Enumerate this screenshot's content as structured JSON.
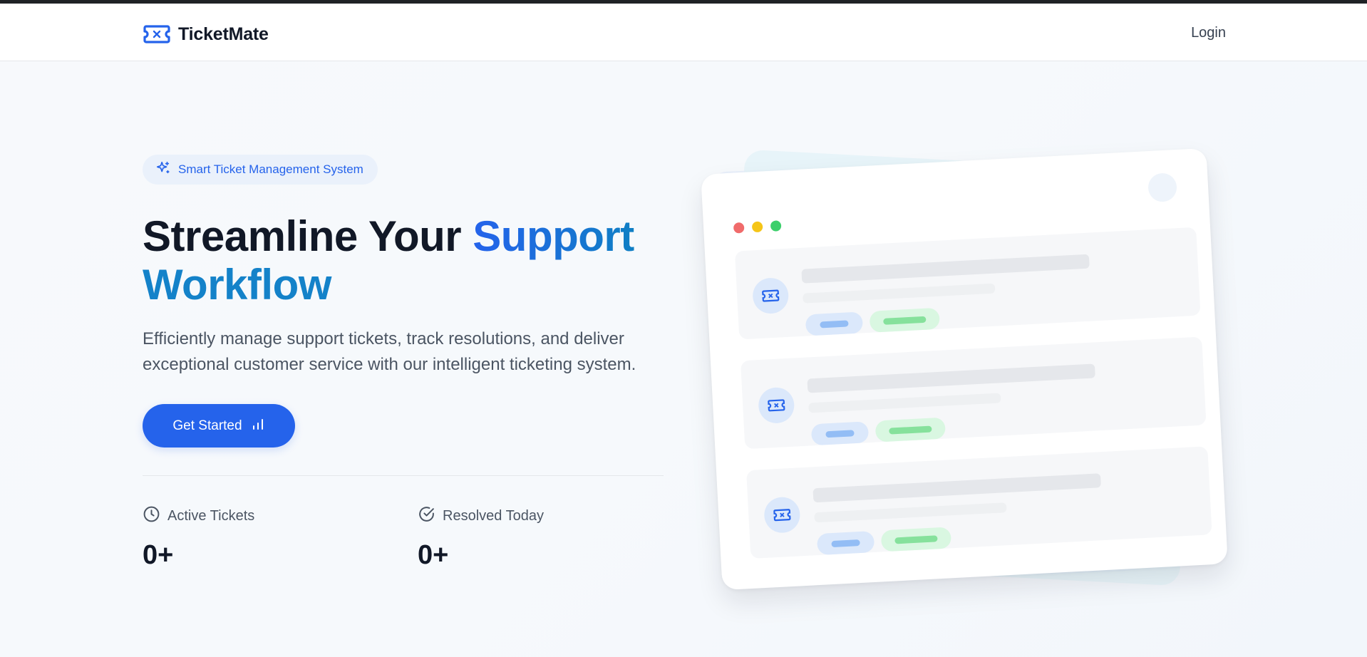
{
  "brand": {
    "name": "TicketMate",
    "icon": "ticket-icon",
    "color": "#2563eb"
  },
  "nav": {
    "login_label": "Login"
  },
  "hero": {
    "badge_text": "Smart Ticket Management System",
    "badge_icon": "sparkles-icon",
    "headline_part1": "Streamline Your ",
    "headline_accent1": "Support",
    "headline_accent2": "Workflow",
    "description": "Efficiently manage support tickets, track resolutions, and deliver exceptional customer service with our intelligent ticketing system.",
    "cta_label": "Get Started",
    "cta_icon": "bar-chart-icon"
  },
  "stats": [
    {
      "label": "Active Tickets",
      "value": "0+",
      "icon": "clock-icon"
    },
    {
      "label": "Resolved Today",
      "value": "0+",
      "icon": "check-circle-icon"
    }
  ],
  "illustration": {
    "window_dots": [
      "#f06b6b",
      "#f5c518",
      "#3ccf6b"
    ],
    "ticket_rows": 3,
    "row_icon": "ticket-icon"
  },
  "colors": {
    "primary": "#2563eb",
    "accent_teal": "#0f7fc4",
    "text_dark": "#111827",
    "text_muted": "#4b5563"
  }
}
